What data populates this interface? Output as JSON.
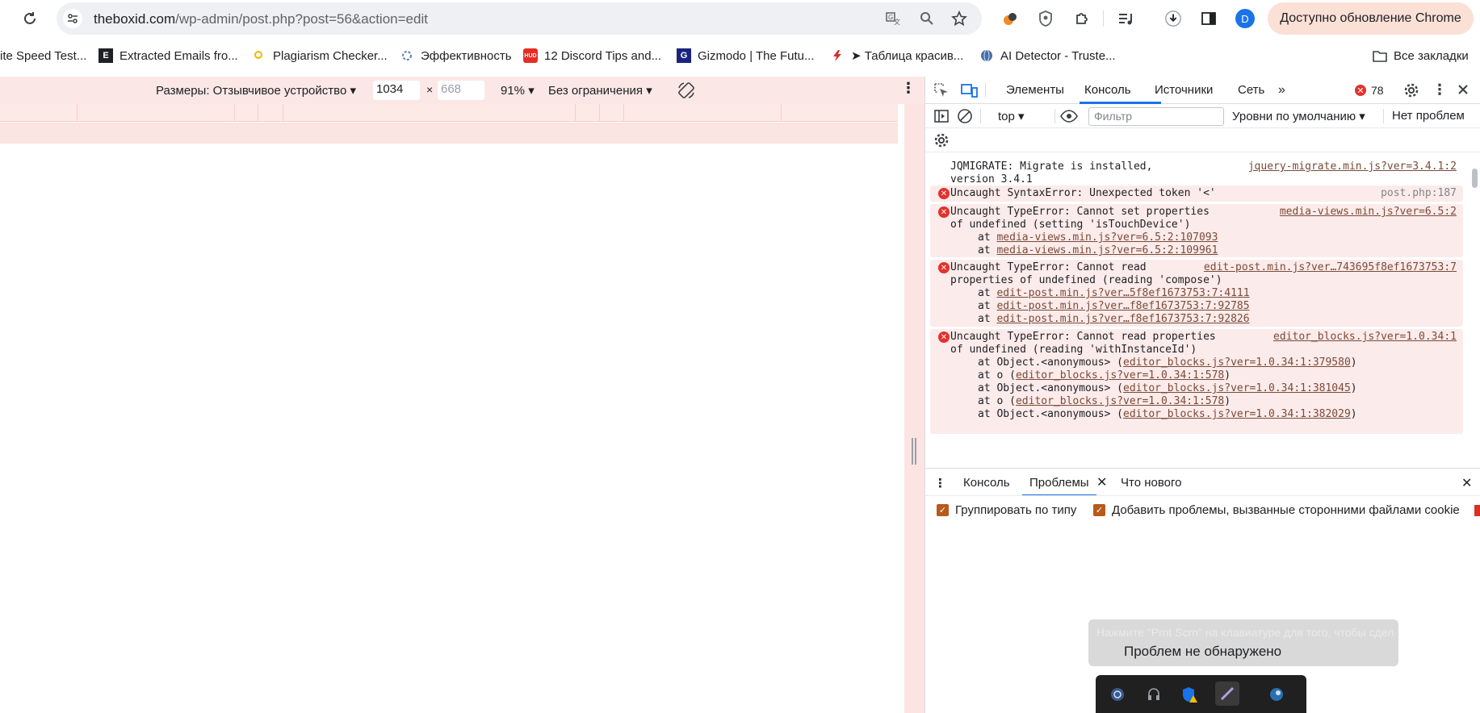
{
  "browser": {
    "url_host": "theboxid.com",
    "url_path": "/wp-admin/post.php?post=56&action=edit",
    "update_button": "Доступно обновление Chrome",
    "avatar_letter": "D"
  },
  "bookmarks": {
    "items": [
      {
        "label": "ite Speed Test...",
        "icon": "none"
      },
      {
        "label": "Extracted Emails fro...",
        "icon": "E"
      },
      {
        "label": "Plagiarism Checker...",
        "icon": "search-icon"
      },
      {
        "label": "Эффективность",
        "icon": "gear-icon"
      },
      {
        "label": "12 Discord Tips and...",
        "icon": "hud-icon"
      },
      {
        "label": "Gizmodo | The Futu...",
        "icon": "G"
      },
      {
        "label": "➤ Таблица красив...",
        "icon": "bolt-icon"
      },
      {
        "label": "AI Detector - Truste...",
        "icon": "globe-icon"
      }
    ],
    "all_bookmarks": "Все закладки"
  },
  "device_toolbar": {
    "dimensions_label": "Размеры: Отзывчивое устройство",
    "width": "1034",
    "height_placeholder": "668",
    "zoom": "91%",
    "throttle": "Без ограничения"
  },
  "devtools": {
    "tabs": [
      "Элементы",
      "Консоль",
      "Источники",
      "Сеть"
    ],
    "active_tab": "Консоль",
    "error_count": "78",
    "context": "top",
    "filter_placeholder": "Фильтр",
    "levels": "Уровни по умолчанию",
    "issues": "Нет проблем",
    "drawer_tabs": [
      "Консоль",
      "Проблемы",
      "Что нового"
    ],
    "group_by_type": "Группировать по типу",
    "third_party": "Добавить проблемы, вызванные сторонними файлами cookie"
  },
  "console": {
    "msg1": {
      "line1": "JQMIGRATE: Migrate is installed,",
      "line2": "version 3.4.1",
      "source": "jquery-migrate.min.js?ver=3.4.1:2"
    },
    "msg2": {
      "line1": "Uncaught SyntaxError: Unexpected token '<'",
      "source": "post.php:187"
    },
    "msg3": {
      "line1": "Uncaught TypeError: Cannot set properties",
      "line2": "of undefined (setting 'isTouchDevice')",
      "source": "media-views.min.js?ver=6.5:2",
      "at1": "media-views.min.js?ver=6.5:2:107093",
      "at2": "media-views.min.js?ver=6.5:2:109961"
    },
    "msg4": {
      "line1": "Uncaught TypeError: Cannot read",
      "line2": "properties of undefined (reading 'compose')",
      "source": "edit-post.min.js?ver…743695f8ef1673753:7",
      "at1": "edit-post.min.js?ver…5f8ef1673753:7:4111",
      "at2": "edit-post.min.js?ver…f8ef1673753:7:92785",
      "at3": "edit-post.min.js?ver…f8ef1673753:7:92826"
    },
    "msg5": {
      "line1": "Uncaught TypeError: Cannot read properties",
      "line2": "of undefined (reading 'withInstanceId')",
      "source": "editor_blocks.js?ver=1.0.34:1",
      "at1_pre": "at Object.<anonymous> (",
      "at1": "editor_blocks.js?ver=1.0.34:1:379580",
      "at2_pre": "at o (",
      "at2": "editor_blocks.js?ver=1.0.34:1:578",
      "at3_pre": "at Object.<anonymous> (",
      "at3": "editor_blocks.js?ver=1.0.34:1:381045",
      "at4_pre": "at o (",
      "at4": "editor_blocks.js?ver=1.0.34:1:578",
      "at5_pre": "at Object.<anonymous> (",
      "at5": "editor_blocks.js?ver=1.0.34:1:382029"
    },
    "at_word": "at",
    "close_paren": ")"
  },
  "toast": {
    "ghost": "Нажмите \"Prnt Scrn\" на клавиатуре для того, чтобы сдел",
    "text": "Проблем не обнаружено"
  }
}
